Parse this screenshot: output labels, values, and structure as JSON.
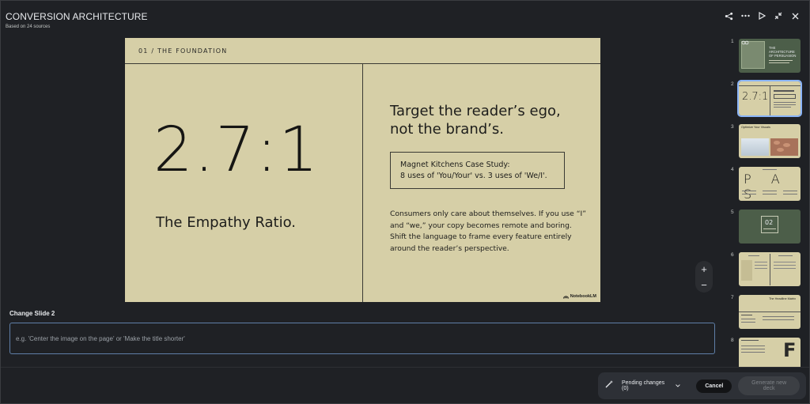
{
  "header": {
    "title": "CONVERSION ARCHITECTURE",
    "subtitle": "Based on 24 sources",
    "icons": [
      "share-icon",
      "more-icon",
      "play-icon",
      "collapse-icon",
      "close-icon"
    ]
  },
  "slide": {
    "kicker": "01 / THE FOUNDATION",
    "big_number": "2.7:1",
    "big_caption": "The Empathy Ratio.",
    "headline": "Target the reader’s ego, not the brand’s.",
    "case_study_line1": "Magnet Kitchens Case Study:",
    "case_study_line2": "8 uses of 'You/Your' vs. 3 uses of 'We/I'.",
    "body": "Consumers only care about themselves. If you use “I” and “we,” your copy becomes remote and boring. Shift the language to frame every feature entirely around the reader’s perspective.",
    "brand": "NotebookLM",
    "colors": {
      "background": "#d6cfa7",
      "ink": "#1d1d1b"
    }
  },
  "zoom": {
    "in_label": "+",
    "out_label": "−"
  },
  "thumbnails": [
    {
      "num": "1",
      "bg": "#4c5e49",
      "label": "THE ARCHITECTURE OF PERSUASION"
    },
    {
      "num": "2",
      "bg": "#d6cfa7",
      "label": "2.7:1",
      "selected": true
    },
    {
      "num": "3",
      "bg": "#d6cfa7",
      "label": "Optimize Your Visuals"
    },
    {
      "num": "4",
      "bg": "#d6cfa7",
      "label": "P A S"
    },
    {
      "num": "5",
      "bg": "#4c5e49",
      "label": "02"
    },
    {
      "num": "6",
      "bg": "#d6cfa7",
      "label": ""
    },
    {
      "num": "7",
      "bg": "#d6cfa7",
      "label": "The Headline Matrix"
    },
    {
      "num": "8",
      "bg": "#d6cfa7",
      "label": "F"
    }
  ],
  "editor": {
    "label": "Change Slide 2",
    "placeholder": "e.g. 'Center the image on the page' or 'Make the title shorter'"
  },
  "actions": {
    "pending": "Pending changes (0)",
    "cancel": "Cancel",
    "generate": "Generate new deck"
  }
}
